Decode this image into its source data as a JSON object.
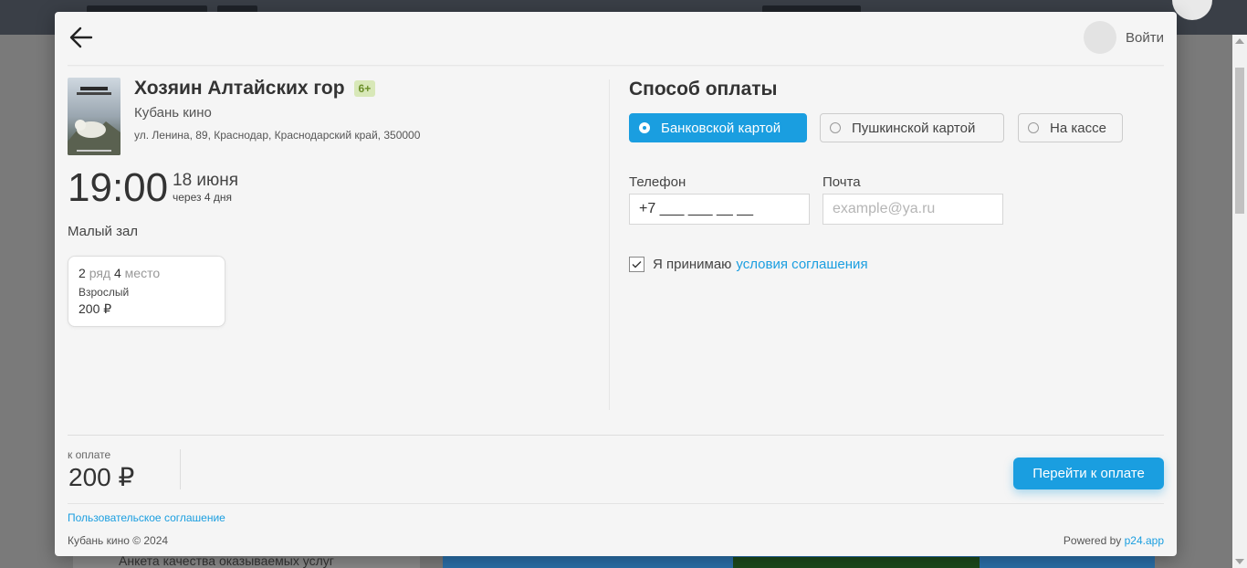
{
  "background": {
    "survey_text": "Анкета качества оказываемых услуг"
  },
  "header": {
    "login_label": "Войти"
  },
  "movie": {
    "title": "Хозяин Алтайских гор",
    "age_rating": "6+",
    "cinema": "Кубань кино",
    "address": "ул. Ленина, 89, Краснодар, Краснодарский край, 350000",
    "time": "19:00",
    "date": "18 июня",
    "date_relative": "через 4 дня",
    "hall": "Малый зал"
  },
  "ticket": {
    "row": "2",
    "row_word": "ряд",
    "seat": "4",
    "seat_word": "место",
    "type": "Взрослый",
    "price": "200 ₽"
  },
  "payment": {
    "title": "Способ оплаты",
    "options": [
      {
        "label": "Банковской картой",
        "selected": true
      },
      {
        "label": "Пушкинской картой",
        "selected": false
      },
      {
        "label": "На кассе",
        "selected": false
      }
    ],
    "phone_label": "Телефон",
    "phone_value": "+7 ___ ___ __ __",
    "email_label": "Почта",
    "email_placeholder": "example@ya.ru",
    "agree_text": "Я принимаю",
    "agree_link": "условия соглашения",
    "agree_checked": true
  },
  "footer": {
    "to_pay_label": "к оплате",
    "to_pay_amount": "200 ₽",
    "pay_button": "Перейти к оплате",
    "user_agreement": "Пользовательское соглашение",
    "copyright": "Кубань кино © 2024",
    "powered_by": "Powered by",
    "powered_link": "p24.app"
  },
  "colors": {
    "accent": "#1a9ee0",
    "age_badge_bg": "#d8e8b8",
    "age_badge_text": "#6b8f2a"
  }
}
